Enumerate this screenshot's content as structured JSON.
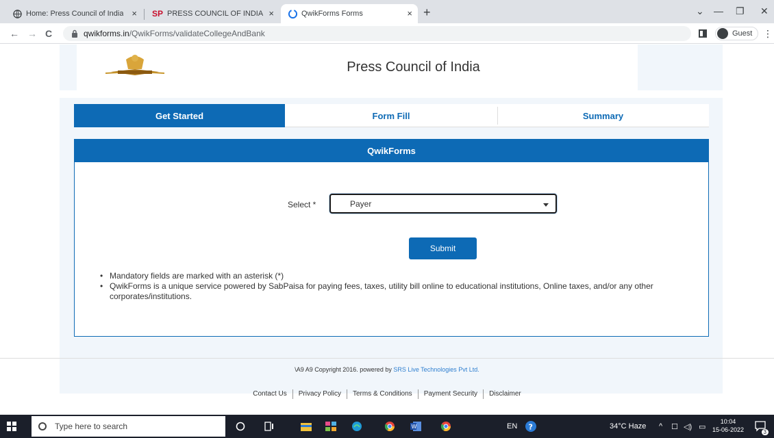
{
  "browser": {
    "tabs": [
      {
        "title": "Home: Press Council of India",
        "close": "×"
      },
      {
        "title": "PRESS COUNCIL OF INDIA",
        "favicon_text": "SP",
        "close": "×"
      },
      {
        "title": "QwikForms Forms",
        "close": "×"
      }
    ],
    "new_tab": "+",
    "window": {
      "minimize": "—",
      "restore": "❐",
      "close": "✕",
      "menu": "⌄"
    },
    "nav": {
      "back": "←",
      "forward": "→",
      "reload": "C"
    },
    "url": {
      "host": "qwikforms.in",
      "path": "/QwikForms/validateCollegeAndBank"
    },
    "profile": "Guest",
    "menu": "⋮"
  },
  "header": {
    "title": "Press Council of India"
  },
  "steps": [
    {
      "label": "Get Started",
      "active": true
    },
    {
      "label": "Form Fill",
      "active": false
    },
    {
      "label": "Summary",
      "active": false
    }
  ],
  "panel": {
    "title": "QwikForms",
    "select_label": "Select *",
    "select_value": "Payer",
    "submit_label": "Submit",
    "notes": [
      "Mandatory fields are marked with an asterisk (*)",
      "QwikForms is a unique service powered by SabPaisa for paying fees, taxes, utility bill online to educational institutions, Online taxes, and/or any other corporates/institutions."
    ]
  },
  "footer": {
    "copyright_prefix": "\\A9 A9 Copyright 2016. powered by ",
    "copyright_link": "SRS Live Technologies Pvt Ltd.",
    "links": [
      "Contact Us",
      "Privacy Policy",
      "Terms & Conditions",
      "Payment Security",
      "Disclaimer"
    ]
  },
  "taskbar": {
    "search_placeholder": "Type here to search",
    "language": "EN",
    "weather": "34°C  Haze",
    "time": "10:04",
    "date": "15-06-2022",
    "notifications": "3"
  },
  "colors": {
    "primary": "#0d6ab5",
    "band": "#f1f6fb",
    "taskbar": "#1b1f2a"
  }
}
